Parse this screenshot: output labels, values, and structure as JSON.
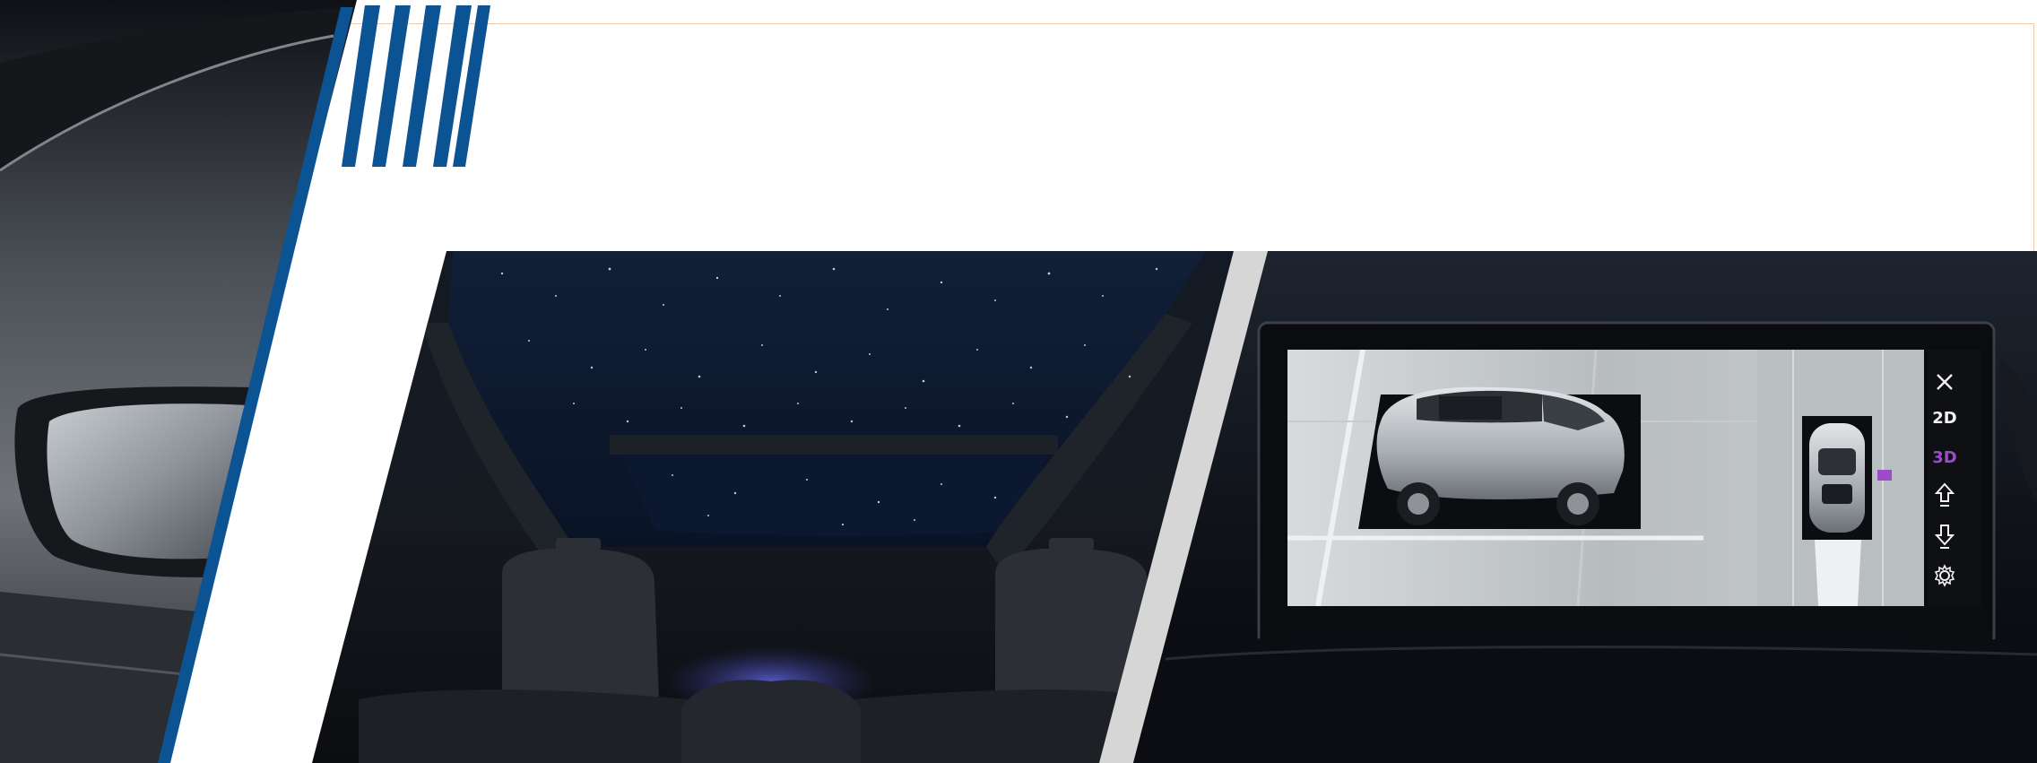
{
  "screen_controls": {
    "mode_2d_label": "2D",
    "mode_3d_label": "3D"
  },
  "colors": {
    "accent_blue": "#0b5393",
    "guide_line": "#f1c8a8",
    "divider_gray": "#d6d6d6",
    "active_mode": "#9c4cc9"
  },
  "icons": {
    "close": "close-icon",
    "forward": "arrow-up-icon",
    "reverse": "arrow-down-icon",
    "settings": "gear-icon"
  }
}
